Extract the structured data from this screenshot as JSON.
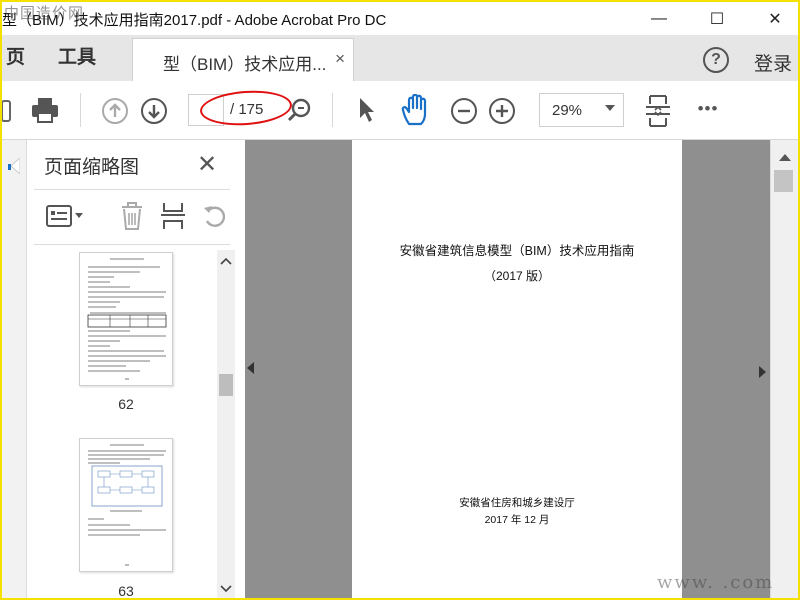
{
  "window": {
    "title": "型（BIM）技术应用指南2017.pdf - Adobe Acrobat Pro DC",
    "minimize_glyph": "—",
    "maximize_glyph": "☐",
    "close_glyph": "✕"
  },
  "watermarks": {
    "top_left": "中国造价网",
    "bottom_right": "www.          .com"
  },
  "tabs": {
    "nav": [
      "页",
      "工具"
    ],
    "document_tab_label": "型（BIM）技术应用...",
    "close_glyph": "×",
    "help_glyph": "?",
    "login_label": "登录"
  },
  "toolbar": {
    "icons": [
      "print-icon",
      "page-up-icon",
      "page-down-icon",
      "zoom-search-icon",
      "select-arrow-icon",
      "hand-tool-icon",
      "zoom-out-icon",
      "zoom-in-icon",
      "fit-page-icon",
      "more-icon"
    ],
    "page_current": "",
    "page_total": "/ 175",
    "zoom_value": "29%",
    "more_glyph": "•••",
    "annotation_color": "#e01010"
  },
  "thumbnails": {
    "title": "页面缩略图",
    "close_glyph": "✕",
    "pages": [
      {
        "number": "62"
      },
      {
        "number": "63"
      }
    ]
  },
  "document": {
    "title": "安徽省建筑信息模型（BIM）技术应用指南",
    "edition": "（2017 版）",
    "publisher": "安徽省住房和城乡建设厅",
    "date": "2017 年 12 月"
  },
  "colors": {
    "tab_bar_bg": "#e6e6e6",
    "doc_bg": "#8f8f8f",
    "frame": "#f5e000"
  }
}
